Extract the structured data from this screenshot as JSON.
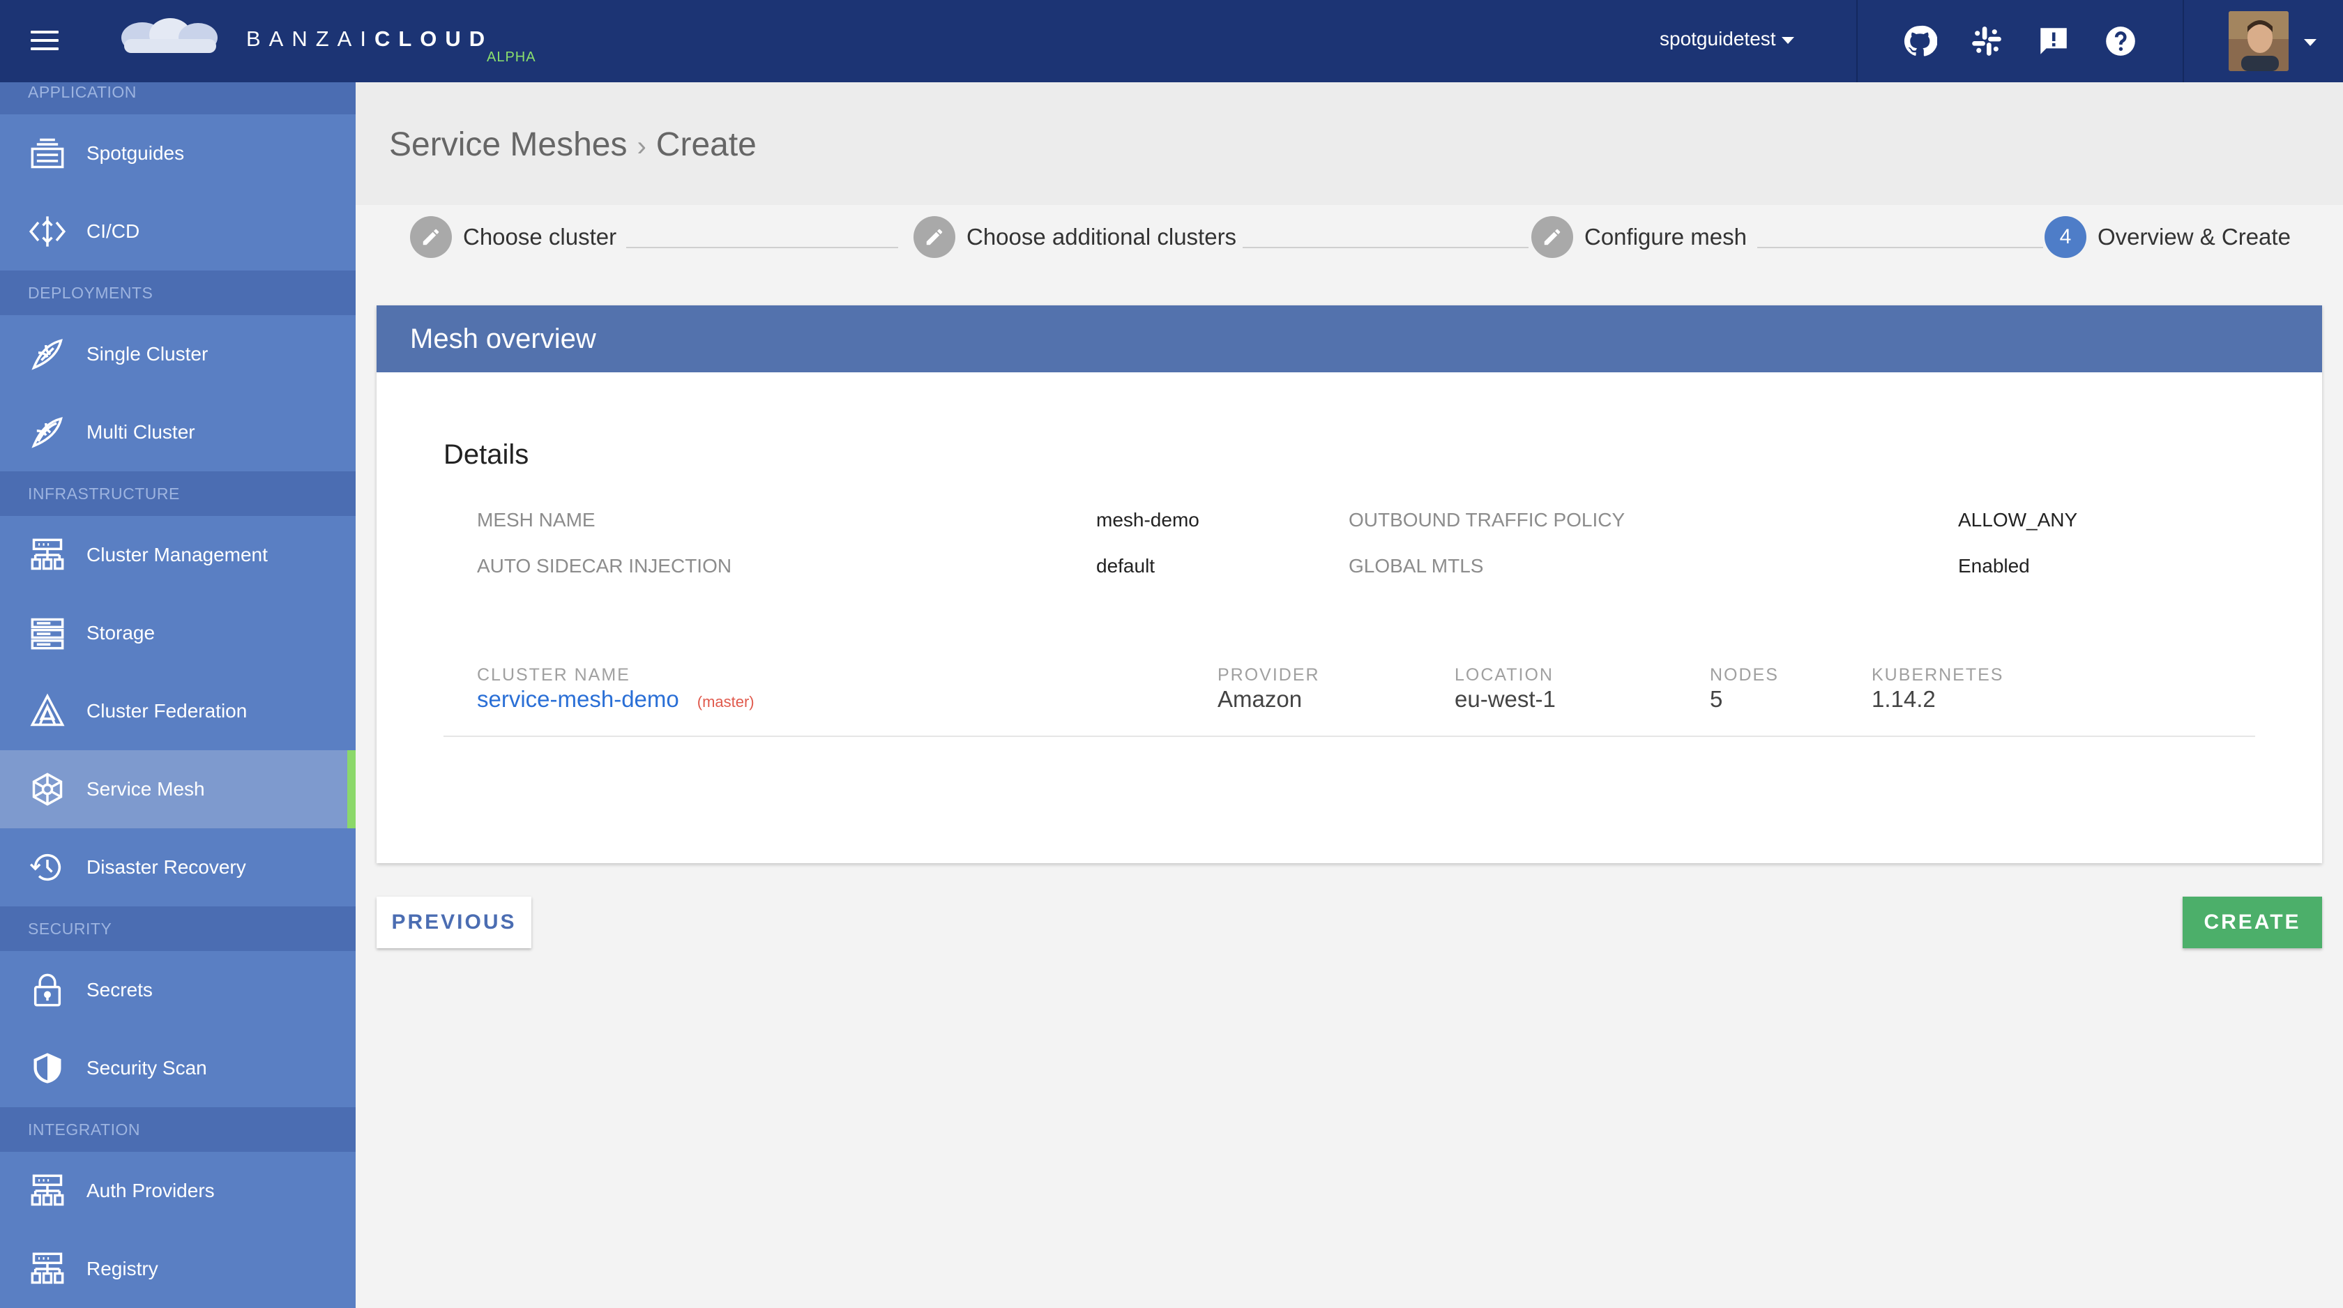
{
  "brand": {
    "name_light": "BANZAI",
    "name_bold": "CLOUD",
    "badge": "ALPHA",
    "icon": "cloud-logo-icon"
  },
  "topbar": {
    "org": "spotguidetest",
    "icons": [
      "github-icon",
      "slack-icon",
      "feedback-icon",
      "help-icon"
    ],
    "background": "#1c3474"
  },
  "sidebar": {
    "sections": [
      {
        "title": "APPLICATION",
        "items": [
          {
            "label": "Spotguides",
            "icon": "spotguides-icon"
          },
          {
            "label": "CI/CD",
            "icon": "cicd-icon"
          }
        ]
      },
      {
        "title": "DEPLOYMENTS",
        "items": [
          {
            "label": "Single Cluster",
            "icon": "single-cluster-icon"
          },
          {
            "label": "Multi Cluster",
            "icon": "multi-cluster-icon"
          }
        ]
      },
      {
        "title": "INFRASTRUCTURE",
        "items": [
          {
            "label": "Cluster Management",
            "icon": "cluster-management-icon"
          },
          {
            "label": "Storage",
            "icon": "storage-icon"
          },
          {
            "label": "Cluster Federation",
            "icon": "cluster-federation-icon"
          },
          {
            "label": "Service Mesh",
            "icon": "service-mesh-icon",
            "active": true
          },
          {
            "label": "Disaster Recovery",
            "icon": "disaster-recovery-icon"
          }
        ]
      },
      {
        "title": "SECURITY",
        "items": [
          {
            "label": "Secrets",
            "icon": "lock-icon"
          },
          {
            "label": "Security Scan",
            "icon": "shield-icon"
          }
        ]
      },
      {
        "title": "INTEGRATION",
        "items": [
          {
            "label": "Auth Providers",
            "icon": "auth-providers-icon"
          },
          {
            "label": "Registry",
            "icon": "registry-icon"
          }
        ]
      }
    ],
    "accent": "#8bd86a"
  },
  "breadcrumb": {
    "parent": "Service Meshes",
    "current": "Create"
  },
  "stepper": {
    "steps": [
      {
        "label": "Choose cluster",
        "state": "done"
      },
      {
        "label": "Choose additional clusters",
        "state": "done"
      },
      {
        "label": "Configure mesh",
        "state": "done"
      },
      {
        "label": "Overview & Create",
        "state": "current",
        "number": "4"
      }
    ]
  },
  "overview": {
    "title": "Mesh overview",
    "details_title": "Details",
    "fields": {
      "mesh_name": {
        "label": "MESH NAME",
        "value": "mesh-demo"
      },
      "outbound": {
        "label": "OUTBOUND TRAFFIC POLICY",
        "value": "ALLOW_ANY"
      },
      "sidecar": {
        "label": "AUTO SIDECAR INJECTION",
        "value": "default"
      },
      "mtls": {
        "label": "GLOBAL MTLS",
        "value": "Enabled"
      }
    },
    "table": {
      "headers": [
        "CLUSTER NAME",
        "PROVIDER",
        "LOCATION",
        "NODES",
        "KUBERNETES"
      ],
      "rows": [
        {
          "name": "service-mesh-demo",
          "tag": "(master)",
          "provider": "Amazon",
          "location": "eu-west-1",
          "nodes": "5",
          "kubernetes": "1.14.2"
        }
      ]
    }
  },
  "actions": {
    "previous": "PREVIOUS",
    "create": "CREATE",
    "create_color": "#4caf6a"
  }
}
